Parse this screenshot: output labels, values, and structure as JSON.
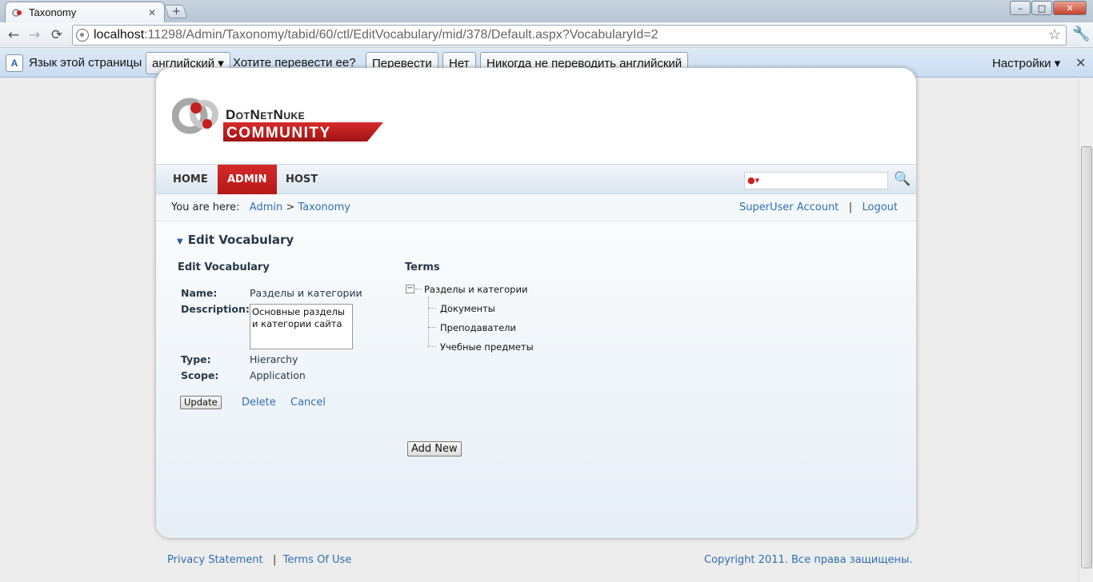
{
  "browser": {
    "tab_title": "Taxonomy",
    "url_host": "localhost",
    "url_path": ":11298/Admin/Taxonomy/tabid/60/ctl/EditVocabulary/mid/378/Default.aspx?VocabularyId=2",
    "new_tab_glyph": "+",
    "back_glyph": "←",
    "forward_glyph": "→",
    "reload_glyph": "⟳",
    "star_glyph": "☆",
    "wrench_glyph": "🔧",
    "min_glyph": "–",
    "max_glyph": "□",
    "close_glyph": "✕"
  },
  "translate_bar": {
    "prompt": "Язык этой страницы",
    "language": "английский ▾",
    "question": "Хотите перевести ее?",
    "translate_btn": "Перевести",
    "no_btn": "Нет",
    "never_btn": "Никогда не переводить английский",
    "settings": "Настройки ▾",
    "close": "✕"
  },
  "site": {
    "logo_top": "DotNetNuke",
    "logo_bottom": "COMMUNITY",
    "menu": [
      "HOME",
      "ADMIN",
      "HOST"
    ],
    "active_menu": "ADMIN",
    "search_glyph": "🔍"
  },
  "breadcrumb": {
    "prefix": "You are here:",
    "items": [
      "Admin",
      "Taxonomy"
    ],
    "separator": ">",
    "account": "SuperUser Account",
    "pipe": "|",
    "logout": "Logout"
  },
  "module": {
    "title": "Edit Vocabulary",
    "section_title": "Edit Vocabulary",
    "name_label": "Name:",
    "name_value": "Разделы и категории",
    "description_label": "Description:",
    "description_value": "Основные разделы и категории сайта",
    "type_label": "Type:",
    "type_value": "Hierarchy",
    "scope_label": "Scope:",
    "scope_value": "Application",
    "update_btn": "Update",
    "delete_link": "Delete",
    "cancel_link": "Cancel",
    "terms_title": "Terms",
    "tree_toggle": "−",
    "tree_root": "Разделы и категории",
    "tree_children": [
      "Документы",
      "Преподаватели",
      "Учебные предметы"
    ],
    "add_new_btn": "Add New"
  },
  "footer": {
    "privacy": "Privacy Statement",
    "pipe": "|",
    "terms": "Terms Of Use",
    "copyright": "Copyright 2011. Все права защищены."
  },
  "colors": {
    "brand_red": "#c21f1f",
    "link_blue": "#2f6fae",
    "text_dark": "#283848"
  }
}
